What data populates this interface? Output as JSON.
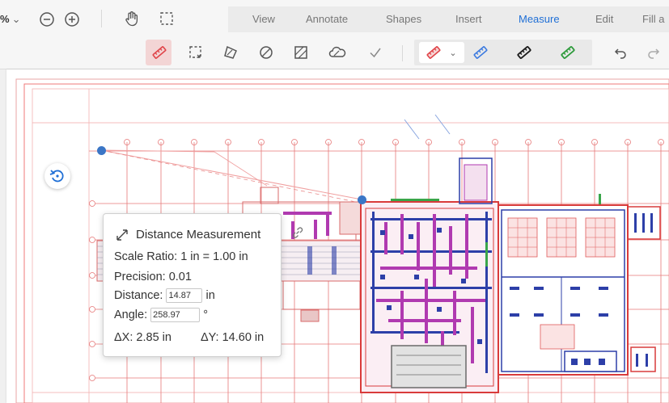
{
  "header": {
    "zoom": "%",
    "tabs": [
      {
        "label": "View"
      },
      {
        "label": "Annotate"
      },
      {
        "label": "Shapes"
      },
      {
        "label": "Insert"
      },
      {
        "label": "Measure",
        "active": true
      },
      {
        "label": "Edit"
      },
      {
        "label": "Fill a"
      }
    ],
    "icons": [
      "zoom-out-icon",
      "zoom-in-icon",
      "pan-hand-icon",
      "select-region-icon"
    ]
  },
  "measure_toolbar": {
    "tools": [
      "distance-ruler-icon",
      "perimeter-icon",
      "area-polygon-icon",
      "ellipse-area-icon",
      "rectangle-area-icon",
      "cloud-area-icon",
      "checkmark-icon"
    ],
    "selected_tool": "distance-ruler-icon",
    "preset_colors": [
      "#e0454a",
      "#3d7be0",
      "#1a1a1a",
      "#2e9b3c"
    ],
    "history": [
      "undo-icon",
      "redo-icon"
    ]
  },
  "measurement": {
    "title": "Distance Measurement",
    "scale_ratio": "Scale Ratio: 1 in = 1.00 in",
    "precision": "Precision: 0.01",
    "distance_label": "Distance:",
    "distance_value": "14.87",
    "distance_unit": "in",
    "angle_label": "Angle:",
    "angle_value": "258.97",
    "angle_unit": "°",
    "dx": "ΔX: 2.85 in",
    "dy": "ΔY: 14.60 in"
  },
  "colors": {
    "accent": "#1f6fd6",
    "ruler_red": "#e0454a",
    "drawing_red": "#e44b4b",
    "drawing_magenta": "#b03ab0",
    "drawing_blue": "#2d3fa8",
    "endpoint": "#3b76c6"
  }
}
